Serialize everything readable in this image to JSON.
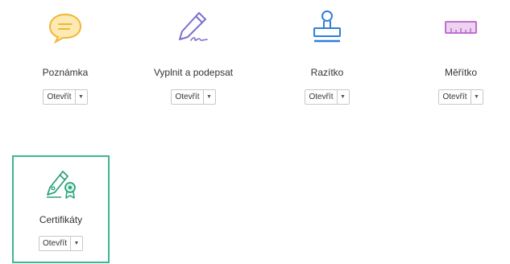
{
  "tools": [
    {
      "label": "Poznámka",
      "open_label": "Otevřít",
      "icon": "comment-icon",
      "color": "#f5c542"
    },
    {
      "label": "Vyplnit a podepsat",
      "open_label": "Otevřít",
      "icon": "fill-sign-icon",
      "color": "#7b6fd0"
    },
    {
      "label": "Razítko",
      "open_label": "Otevřít",
      "icon": "stamp-icon",
      "color": "#2f7fd8"
    },
    {
      "label": "Měřítko",
      "open_label": "Otevřít",
      "icon": "ruler-icon",
      "color": "#b862c9"
    },
    {
      "label": "Certifikáty",
      "open_label": "Otevřít",
      "icon": "certificate-icon",
      "color": "#2aa37c"
    }
  ],
  "selected_border_color": "#3bb78f"
}
